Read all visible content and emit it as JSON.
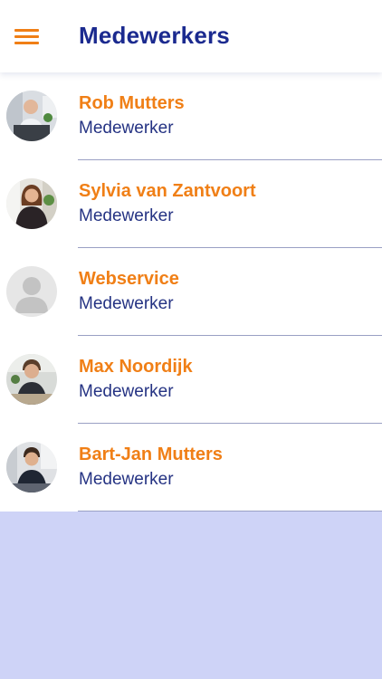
{
  "header": {
    "title": "Medewerkers",
    "menu_icon": "hamburger-menu-icon"
  },
  "colors": {
    "accent": "#f07f16",
    "title": "#1b2a8f",
    "role_text": "#253383",
    "background": "#ced3f7"
  },
  "employees": [
    {
      "name": "Rob Mutters",
      "role": "Medewerker",
      "avatar": "photo"
    },
    {
      "name": "Sylvia van Zantvoort",
      "role": "Medewerker",
      "avatar": "photo"
    },
    {
      "name": "Webservice",
      "role": "Medewerker",
      "avatar": "placeholder-person-icon"
    },
    {
      "name": "Max Noordijk",
      "role": "Medewerker",
      "avatar": "photo"
    },
    {
      "name": "Bart-Jan Mutters",
      "role": "Medewerker",
      "avatar": "photo"
    }
  ]
}
